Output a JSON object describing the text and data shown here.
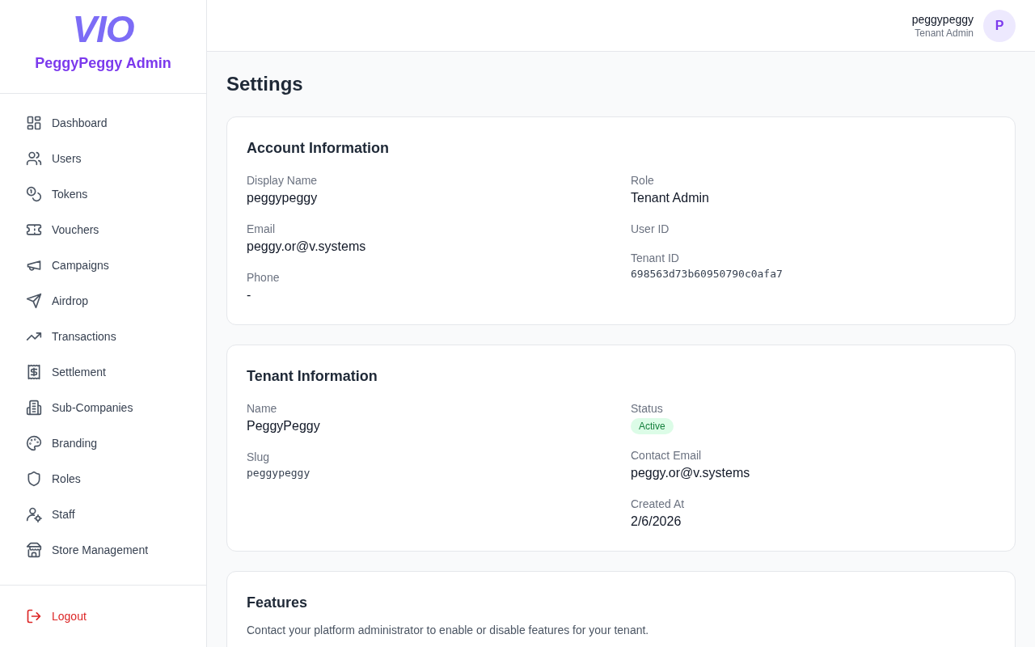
{
  "brand": {
    "logo": "VIO",
    "title": "PeggyPeggy Admin"
  },
  "nav": [
    {
      "label": "Dashboard"
    },
    {
      "label": "Users"
    },
    {
      "label": "Tokens"
    },
    {
      "label": "Vouchers"
    },
    {
      "label": "Campaigns"
    },
    {
      "label": "Airdrop"
    },
    {
      "label": "Transactions"
    },
    {
      "label": "Settlement"
    },
    {
      "label": "Sub-Companies"
    },
    {
      "label": "Branding"
    },
    {
      "label": "Roles"
    },
    {
      "label": "Staff"
    },
    {
      "label": "Store Management"
    }
  ],
  "logout": "Logout",
  "user": {
    "name": "peggypeggy",
    "role": "Tenant Admin",
    "initial": "P"
  },
  "page_title": "Settings",
  "cards": [
    {
      "title": "Account Information",
      "columns": [
        [
          {
            "label": "Display Name",
            "value": "peggypeggy",
            "kind": "text"
          },
          {
            "label": "Email",
            "value": "peggy.or@v.systems",
            "kind": "text"
          },
          {
            "label": "Phone",
            "value": "-",
            "kind": "text"
          }
        ],
        [
          {
            "label": "Role",
            "value": "Tenant Admin",
            "kind": "text"
          },
          {
            "label": "User ID",
            "kind": "empty"
          },
          {
            "label": "Tenant ID",
            "value": "698563d73b60950790c0afa7",
            "kind": "mono"
          }
        ]
      ]
    },
    {
      "title": "Tenant Information",
      "columns": [
        [
          {
            "label": "Name",
            "value": "PeggyPeggy",
            "kind": "text"
          },
          {
            "label": "Slug",
            "value": "peggypeggy",
            "kind": "mono"
          }
        ],
        [
          {
            "label": "Status",
            "value": "Active",
            "kind": "badge"
          },
          {
            "label": "Contact Email",
            "value": "peggy.or@v.systems",
            "kind": "text"
          },
          {
            "label": "Created At",
            "value": "2/6/2026",
            "kind": "text"
          }
        ]
      ]
    },
    {
      "title": "Features",
      "description": "Contact your platform administrator to enable or disable features for your tenant."
    }
  ]
}
